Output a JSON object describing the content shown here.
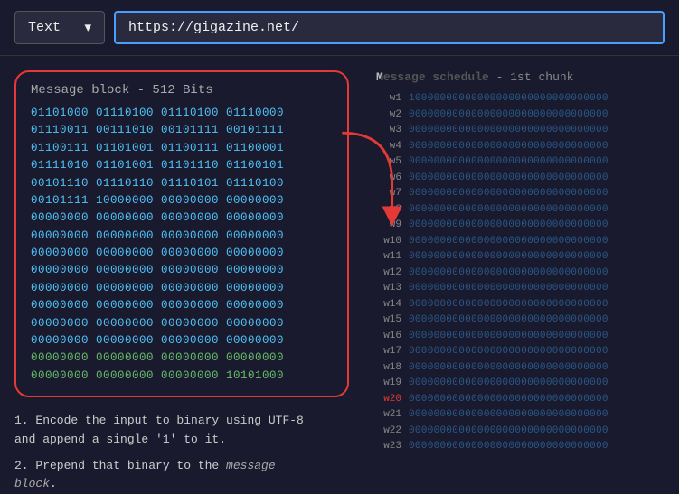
{
  "topbar": {
    "dropdown_label": "Text",
    "dropdown_arrow": "▾",
    "url_value": "https://gigazine.net/"
  },
  "left": {
    "title": "Message block",
    "title_suffix": " - 512 Bits",
    "binary_rows": [
      {
        "text": "01101000 01110100 01110100 01110000",
        "type": "normal"
      },
      {
        "text": "01110011 00111010 00101111 00101111",
        "type": "normal"
      },
      {
        "text": "01100111 01101001 01100111 01100001",
        "type": "normal"
      },
      {
        "text": "01111010 01101001 01101110 01100101",
        "type": "normal"
      },
      {
        "text": "00101110 01110110 01110101 01110100",
        "type": "normal"
      },
      {
        "text": "00101111 10000000 00000000 00000000",
        "type": "normal"
      },
      {
        "text": "00000000 00000000 00000000 00000000",
        "type": "normal"
      },
      {
        "text": "00000000 00000000 00000000 00000000",
        "type": "normal"
      },
      {
        "text": "00000000 00000000 00000000 00000000",
        "type": "normal"
      },
      {
        "text": "00000000 00000000 00000000 00000000",
        "type": "normal"
      },
      {
        "text": "00000000 00000000 00000000 00000000",
        "type": "normal"
      },
      {
        "text": "00000000 00000000 00000000 00000000",
        "type": "normal"
      },
      {
        "text": "00000000 00000000 00000000 00000000",
        "type": "normal"
      },
      {
        "text": "00000000 00000000 00000000 00000000",
        "type": "normal"
      },
      {
        "text": "00000000 00000000 00000000 00000000",
        "type": "green"
      },
      {
        "text": "00000000 00000000 00000000 10101000",
        "type": "green"
      }
    ],
    "notes": [
      "1. Encode the input to binary using UTF-8 and append a single '1' to it.",
      "2. Prepend that binary to the message block."
    ],
    "notes_italic": "message\nblock."
  },
  "right": {
    "title": "Message schedule",
    "title_suffix": "- 1st chunk",
    "rows": [
      {
        "label": "w1",
        "bits": "10000000000000000000000000000000"
      },
      {
        "label": "w2",
        "bits": "00000000000000000000000000000000"
      },
      {
        "label": "w3",
        "bits": "00000000000000000000000000000000"
      },
      {
        "label": "w4",
        "bits": "00000000000000000000000000000000"
      },
      {
        "label": "w5",
        "bits": "00000000000000000000000000000000"
      },
      {
        "label": "w6",
        "bits": "00000000000000000000000000000000"
      },
      {
        "label": "w7",
        "bits": "00000000000000000000000000000000"
      },
      {
        "label": "w8",
        "bits": "00000000000000000000000000000000"
      },
      {
        "label": "w9",
        "bits": "00000000000000000000000000000000"
      },
      {
        "label": "w10",
        "bits": "00000000000000000000000000000000"
      },
      {
        "label": "w11",
        "bits": "00000000000000000000000000000000"
      },
      {
        "label": "w12",
        "bits": "00000000000000000000000000000000"
      },
      {
        "label": "w13",
        "bits": "00000000000000000000000000000000"
      },
      {
        "label": "w14",
        "bits": "00000000000000000000000000000000"
      },
      {
        "label": "w15",
        "bits": "00000000000000000000000000000000"
      },
      {
        "label": "w16",
        "bits": "00000000000000000000000000000000"
      },
      {
        "label": "w17",
        "bits": "00000000000000000000000000000000"
      },
      {
        "label": "w18",
        "bits": "00000000000000000000000000000000"
      },
      {
        "label": "w19",
        "bits": "00000000000000000000000000000000"
      },
      {
        "label": "w20",
        "bits": "00000000000000000000000000000000",
        "highlight": true
      },
      {
        "label": "w21",
        "bits": "00000000000000000000000000000000"
      },
      {
        "label": "w22",
        "bits": "00000000000000000000000000000000"
      },
      {
        "label": "w23",
        "bits": "00000000000000000000000000000000"
      }
    ]
  }
}
